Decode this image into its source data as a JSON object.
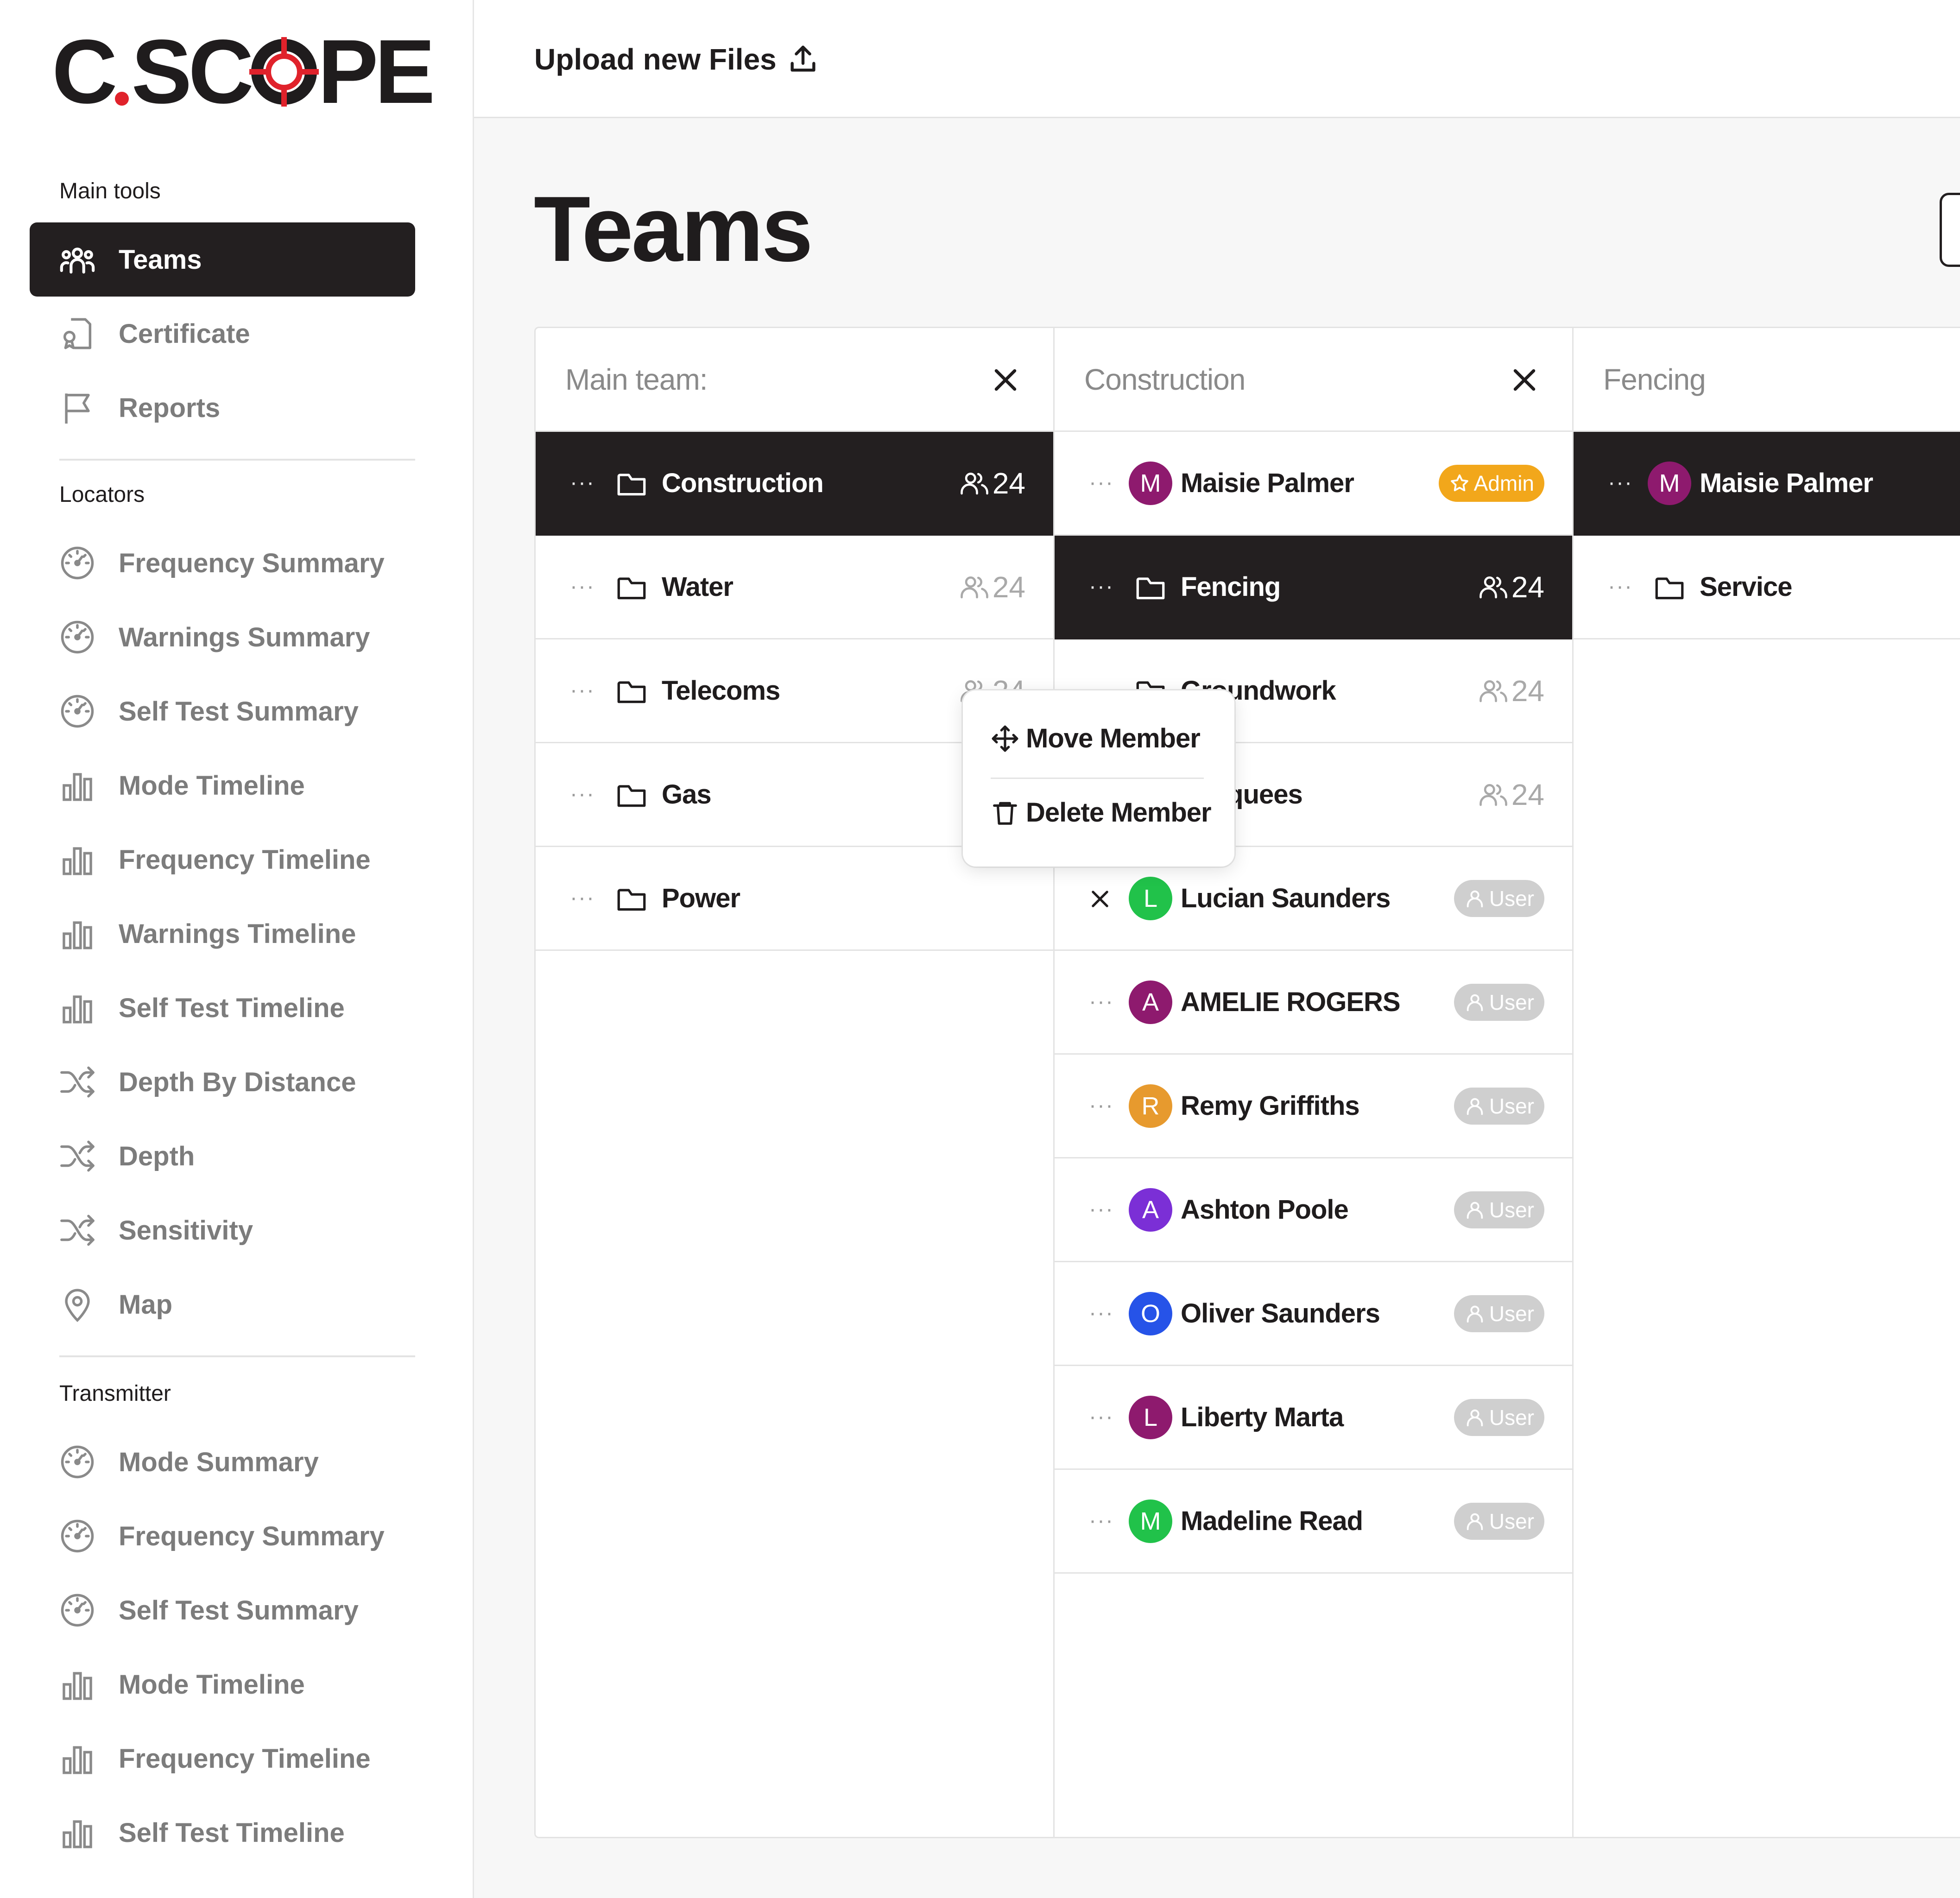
{
  "logo": {
    "left": "C",
    "right": "SC",
    "end": "PE"
  },
  "sidebar": {
    "sections": [
      {
        "title": "Main tools"
      },
      {
        "title": "Locators"
      },
      {
        "title": "Transmitter"
      }
    ],
    "main_tools": [
      {
        "label": "Teams",
        "icon": "teams-icon"
      },
      {
        "label": "Certificate",
        "icon": "certificate-icon"
      },
      {
        "label": "Reports",
        "icon": "flag-icon"
      }
    ],
    "locators": [
      {
        "label": "Frequency Summary",
        "icon": "gauge-icon"
      },
      {
        "label": "Warnings Summary",
        "icon": "gauge-icon"
      },
      {
        "label": "Self Test Summary",
        "icon": "gauge-icon"
      },
      {
        "label": "Mode Timeline",
        "icon": "bar-chart-icon"
      },
      {
        "label": "Frequency Timeline",
        "icon": "bar-chart-icon"
      },
      {
        "label": "Warnings Timeline",
        "icon": "bar-chart-icon"
      },
      {
        "label": "Self Test Timeline",
        "icon": "bar-chart-icon"
      },
      {
        "label": "Depth By Distance",
        "icon": "shuffle-icon"
      },
      {
        "label": "Depth",
        "icon": "shuffle-icon"
      },
      {
        "label": "Sensitivity",
        "icon": "shuffle-icon"
      },
      {
        "label": "Map",
        "icon": "map-pin-icon"
      }
    ],
    "transmitter": [
      {
        "label": "Mode Summary",
        "icon": "gauge-icon"
      },
      {
        "label": "Frequency Summary",
        "icon": "gauge-icon"
      },
      {
        "label": "Self Test Summary",
        "icon": "gauge-icon"
      },
      {
        "label": "Mode Timeline",
        "icon": "bar-chart-icon"
      },
      {
        "label": "Frequency Timeline",
        "icon": "bar-chart-icon"
      },
      {
        "label": "Self Test Timeline",
        "icon": "bar-chart-icon"
      }
    ]
  },
  "topbar": {
    "upload_label": "Upload new Files"
  },
  "page": {
    "title": "Teams"
  },
  "columns": [
    {
      "title": "Main team:",
      "rows": [
        {
          "type": "folder",
          "label": "Construction",
          "count": "24",
          "selected": true
        },
        {
          "type": "folder",
          "label": "Water",
          "count": "24"
        },
        {
          "type": "folder",
          "label": "Telecoms",
          "count": "24"
        },
        {
          "type": "folder",
          "label": "Gas"
        },
        {
          "type": "folder",
          "label": "Power"
        }
      ]
    },
    {
      "title": "Construction",
      "rows": [
        {
          "type": "member",
          "initial": "M",
          "label": "Maisie Palmer",
          "color": "#8e1a6e",
          "role": "Admin"
        },
        {
          "type": "folder",
          "label": "Fencing",
          "count": "24",
          "selected": true
        },
        {
          "type": "folder",
          "label": "Groundwork",
          "count": "24"
        },
        {
          "type": "folder",
          "label": "Marquees",
          "count": "24"
        },
        {
          "type": "member",
          "initial": "L",
          "label": "Lucian Saunders",
          "color": "#21c24a",
          "role": "User",
          "removing": true
        },
        {
          "type": "member",
          "initial": "A",
          "label": "AMELIE ROGERS",
          "color": "#8e1a6e",
          "role": "User"
        },
        {
          "type": "member",
          "initial": "R",
          "label": "Remy Griffiths",
          "color": "#e79a2e",
          "role": "User"
        },
        {
          "type": "member",
          "initial": "A",
          "label": "Ashton Poole",
          "color": "#7b2fd6",
          "role": "User"
        },
        {
          "type": "member",
          "initial": "O",
          "label": "Oliver Saunders",
          "color": "#2653e8",
          "role": "User"
        },
        {
          "type": "member",
          "initial": "L",
          "label": "Liberty Marta",
          "color": "#8e1a6e",
          "role": "User"
        },
        {
          "type": "member",
          "initial": "M",
          "label": "Madeline Read",
          "color": "#21c24a",
          "role": "User"
        }
      ]
    },
    {
      "title": "Fencing",
      "rows": [
        {
          "type": "member",
          "initial": "M",
          "label": "Maisie Palmer",
          "color": "#8e1a6e",
          "selected": true
        },
        {
          "type": "folder",
          "label": "Service"
        }
      ]
    }
  ],
  "context_menu": {
    "move_label": "Move Member",
    "delete_label": "Delete Member"
  },
  "colors": {
    "dark": "#231f20",
    "admin": "#f2a71b",
    "user_badge": "#cfcfcf",
    "logo_red": "#e0222b"
  }
}
